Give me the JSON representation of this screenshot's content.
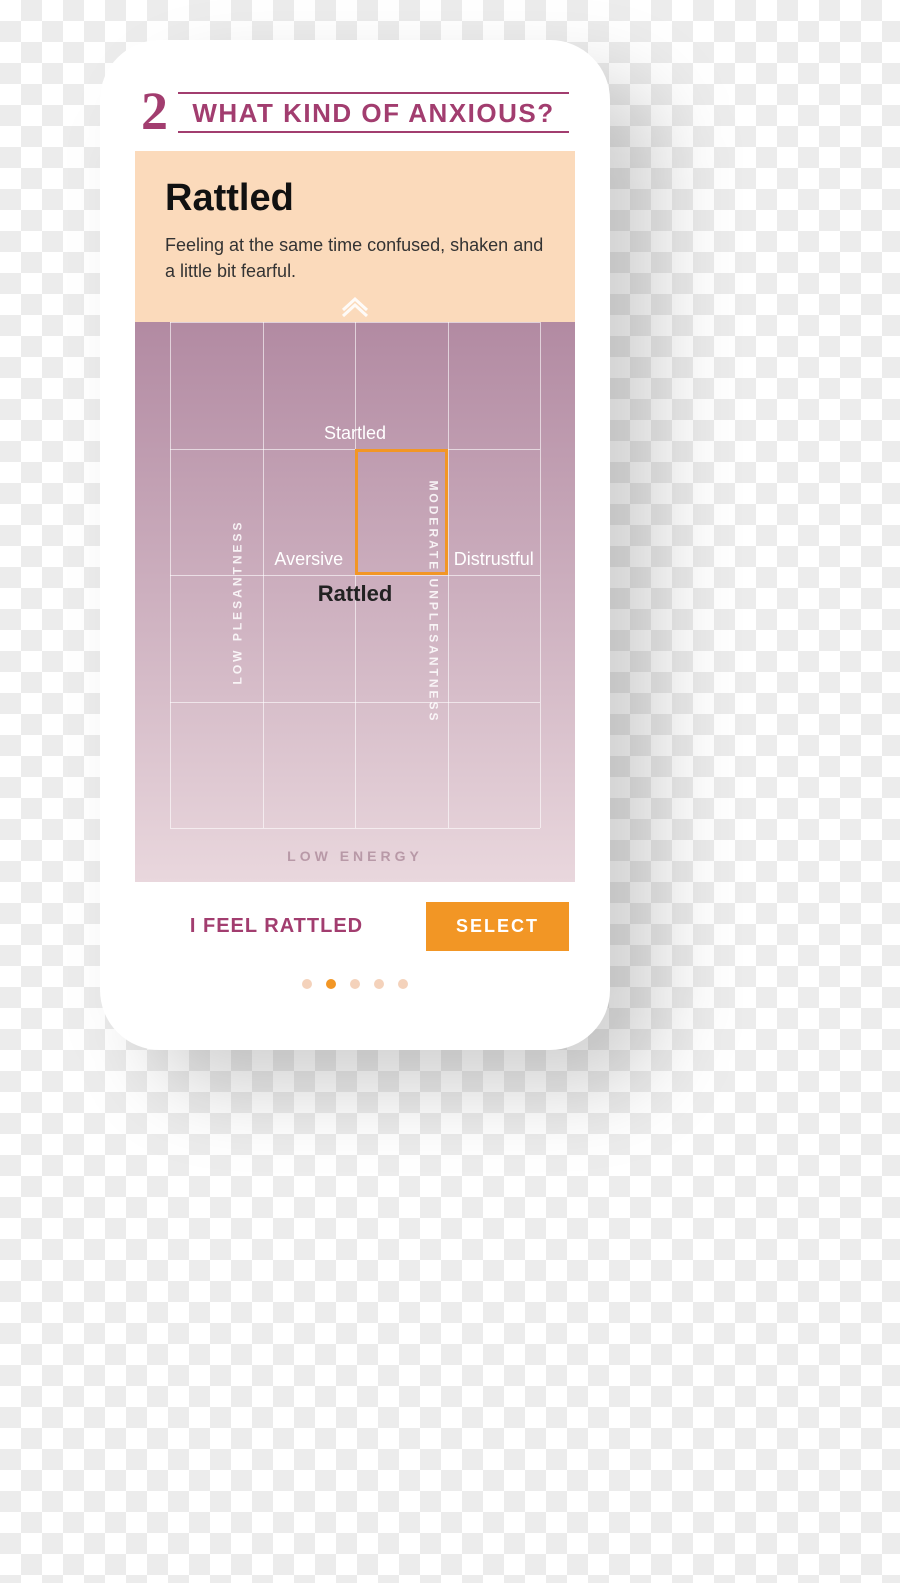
{
  "header": {
    "step": "2",
    "title": "WHAT KIND OF ANXIOUS?"
  },
  "emotion": {
    "name": "Rattled",
    "description": "Feeling at the same time confused, shaken and a little bit fearful."
  },
  "axes": {
    "left": "LOW PLESANTNESS",
    "right": "MODERATE  UNPLESANTNESS",
    "bottom": "LOW ENERGY"
  },
  "labels": {
    "up": "Startled",
    "left": "Aversive",
    "right": "Distrustful",
    "selected": "Rattled"
  },
  "footer": {
    "feel": "I FEEL RATTLED",
    "select": "SELECT"
  },
  "pager": {
    "count": 5,
    "active": 1
  }
}
